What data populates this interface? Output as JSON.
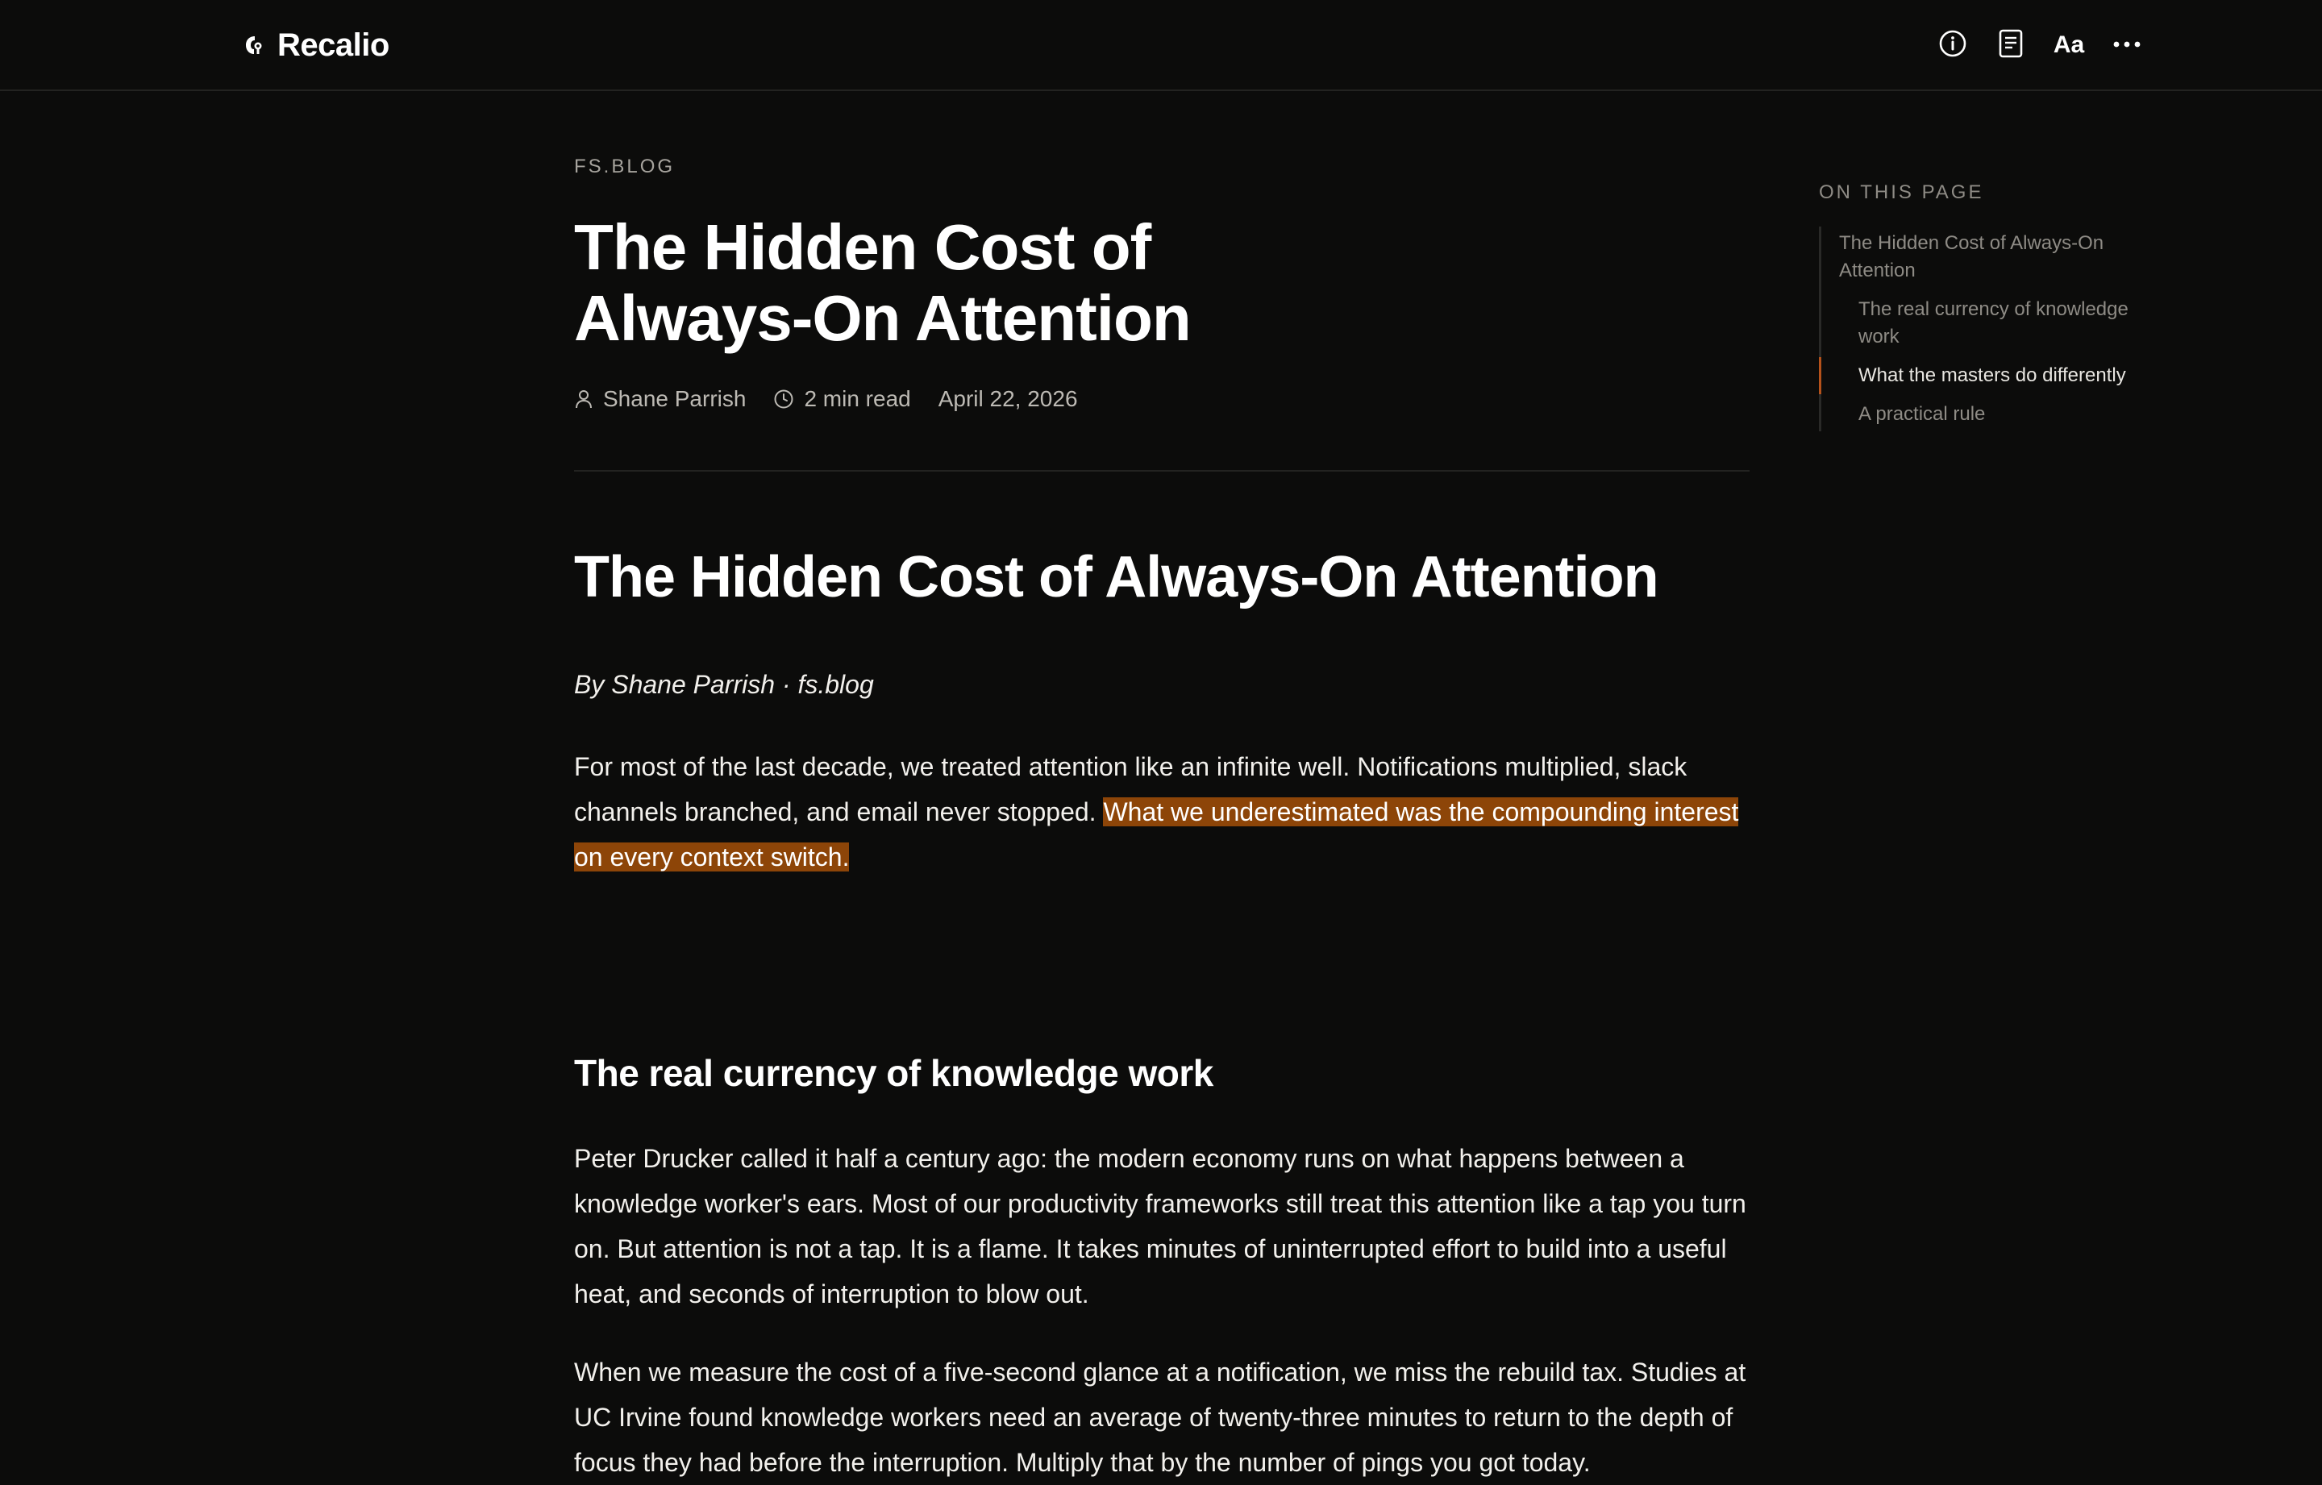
{
  "app": {
    "name": "Recalio"
  },
  "toolbar": {
    "info_icon": "info-circle-icon",
    "reader_icon": "document-icon",
    "typography_label": "Aa",
    "more_icon": "more-horizontal-icon"
  },
  "article": {
    "source": "FS.BLOG",
    "title": "The Hidden Cost of Always-On Attention",
    "author": "Shane Parrish",
    "read_time": "2 min read",
    "date": "April 22, 2026",
    "heading": "The Hidden Cost of Always-On Attention",
    "byline": "By Shane Parrish · fs.blog",
    "p1_text": "For most of the last decade, we treated attention like an infinite well. Notifications multiplied, slack channels branched, and email never stopped. ",
    "p1_highlight": "What we underestimated was the compounding interest on every context switch.",
    "section_heading": "The real currency of knowledge work",
    "p2": "Peter Drucker called it half a century ago: the modern economy runs on what happens between a knowledge worker's ears. Most of our productivity frameworks still treat this attention like a tap you turn on. But attention is not a tap. It is a flame. It takes minutes of uninterrupted effort to build into a useful heat, and seconds of interruption to blow out.",
    "p3": "When we measure the cost of a five-second glance at a notification, we miss the rebuild tax. Studies at UC Irvine found knowledge workers need an average of twenty-three minutes to return to the depth of focus they had before the interruption. Multiply that by the number of pings you got today.",
    "highlight_color": "#8d4508"
  },
  "toc": {
    "heading": "ON THIS PAGE",
    "items": [
      {
        "label": "The Hidden Cost of Always-On Attention",
        "level": 1,
        "active": false
      },
      {
        "label": "The real currency of knowledge work",
        "level": 2,
        "active": false
      },
      {
        "label": "What the masters do differently",
        "level": 2,
        "active": true
      },
      {
        "label": "A practical rule",
        "level": 2,
        "active": false
      }
    ],
    "active_color": "#b5521b"
  }
}
